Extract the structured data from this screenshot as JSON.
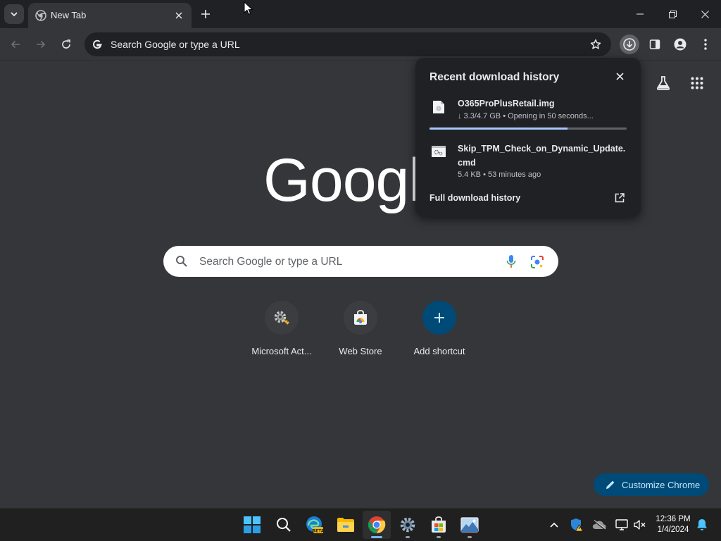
{
  "browser": {
    "tab": {
      "title": "New Tab"
    },
    "omnibox": {
      "placeholder": "Search Google or type a URL"
    }
  },
  "downloads": {
    "title": "Recent download history",
    "items": [
      {
        "name": "O365ProPlusRetail.img",
        "status": "↓ 3.3/4.7 GB • Opening in 50 seconds...",
        "progress": 0.7
      },
      {
        "name": "Skip_TPM_Check_on_Dynamic_Update.cmd",
        "status": "5.4 KB • 53 minutes ago"
      }
    ],
    "full_history_label": "Full download history"
  },
  "ntp": {
    "logo": "Google",
    "search_placeholder": "Search Google or type a URL",
    "shortcuts": [
      {
        "label": "Microsoft Act...",
        "icon": "gear-key-icon"
      },
      {
        "label": "Web Store",
        "icon": "web-store-icon"
      },
      {
        "label": "Add shortcut",
        "icon": "plus-icon"
      }
    ],
    "customize_label": "Customize Chrome"
  },
  "taskbar": {
    "apps": [
      "start-icon",
      "search-icon",
      "edge-beta-icon",
      "file-explorer-icon",
      "chrome-icon",
      "settings-icon",
      "store-icon",
      "photos-icon"
    ],
    "clock": {
      "time": "12:36 PM",
      "date": "1/4/2024"
    }
  },
  "colors": {
    "accent": "#004a77",
    "accent_text": "#c2e7ff",
    "progress": "#a8c7fa",
    "background": "#35363a",
    "frame": "#202124"
  }
}
